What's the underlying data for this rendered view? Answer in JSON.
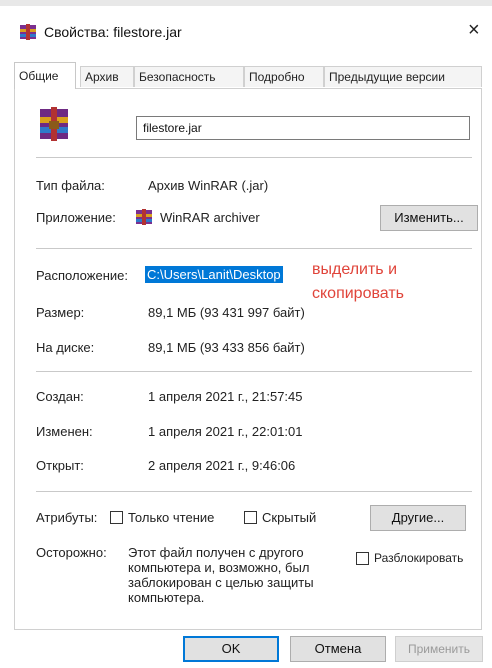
{
  "window": {
    "title": "Свойства: filestore.jar",
    "close_glyph": "×"
  },
  "tabs": [
    {
      "label": "Общие"
    },
    {
      "label": "Архив"
    },
    {
      "label": "Безопасность"
    },
    {
      "label": "Подробно"
    },
    {
      "label": "Предыдущие версии"
    }
  ],
  "general": {
    "filename": "filestore.jar",
    "file_type_label": "Тип файла:",
    "file_type_value": "Архив WinRAR (.jar)",
    "app_label": "Приложение:",
    "app_value": "WinRAR archiver",
    "change_button": "Изменить...",
    "location_label": "Расположение:",
    "location_value": "C:\\Users\\Lanit\\Desktop",
    "annotation_line1": "выделить и",
    "annotation_line2": "скопировать",
    "size_label": "Размер:",
    "size_value": "89,1 МБ (93 431 997 байт)",
    "disk_label": "На диске:",
    "disk_value": "89,1 МБ (93 433 856 байт)",
    "created_label": "Создан:",
    "created_value": "1 апреля 2021 г., 21:57:45",
    "modified_label": "Изменен:",
    "modified_value": "1 апреля 2021 г., 22:01:01",
    "opened_label": "Открыт:",
    "opened_value": "2 апреля 2021 г., 9:46:06",
    "attributes_label": "Атрибуты:",
    "readonly_label": "Только чтение",
    "hidden_label": "Скрытый",
    "other_button": "Другие...",
    "caution_label": "Осторожно:",
    "caution_text": "Этот файл получен с другого компьютера и, возможно, был заблокирован с целью защиты компьютера.",
    "unblock_label": "Разблокировать"
  },
  "footer": {
    "ok": "OK",
    "cancel": "Отмена",
    "apply": "Применить"
  },
  "colors": {
    "selection": "#0078d7",
    "annotation": "#e0443a"
  }
}
